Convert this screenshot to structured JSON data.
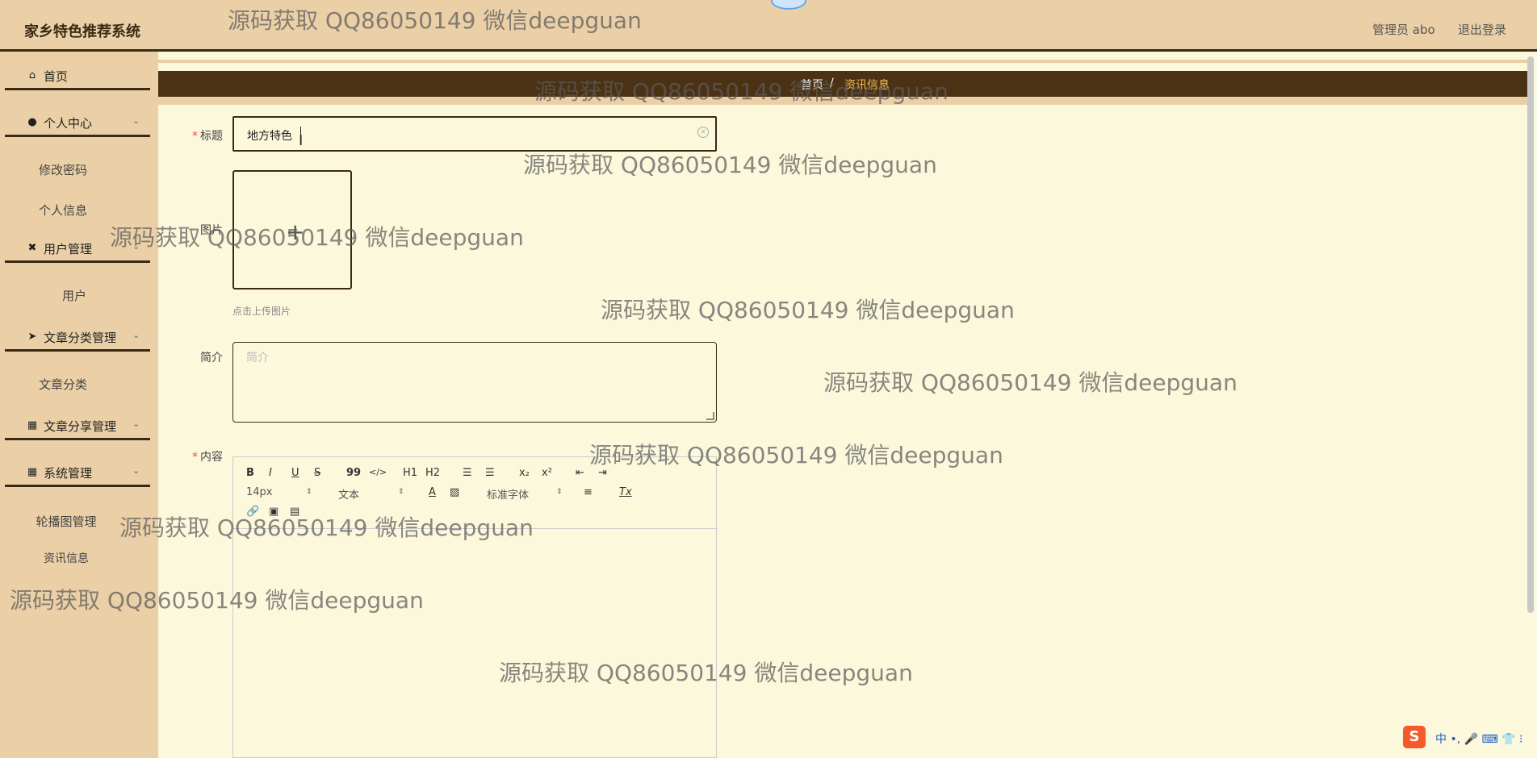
{
  "header": {
    "title": "家乡特色推荐系统",
    "admin": "管理员 abo",
    "logout": "退出登录"
  },
  "sidebar": {
    "home": "首页",
    "personal": "个人中心",
    "change_password": "修改密码",
    "personal_info": "个人信息",
    "user_mgmt": "用户管理",
    "user": "用户",
    "article_cat_mgmt": "文章分类管理",
    "article_cat": "文章分类",
    "article_share_mgmt": "文章分享管理",
    "system_mgmt": "系统管理",
    "carousel_mgmt": "轮播图管理",
    "news_info": "资讯信息"
  },
  "breadcrumb": {
    "home": "首页",
    "sep": "/",
    "current": "资讯信息"
  },
  "form": {
    "title_label": "标题",
    "title_value": "地方特色",
    "image_label": "图片",
    "upload_hint": "点击上传图片",
    "intro_label": "简介",
    "intro_placeholder": "简介",
    "content_label": "内容"
  },
  "editor": {
    "bold": "B",
    "italic": "I",
    "underline": "U",
    "strike": "S",
    "quote": "99",
    "code": "</>",
    "h1": "H1",
    "h2": "H2",
    "sub": "x₂",
    "sup": "x²",
    "size": "14px",
    "format": "文本",
    "font": "标准字体",
    "color": "A",
    "clean": "Tx"
  },
  "watermark": "源码获取 QQ86050149 微信deepguan",
  "ime": {
    "logo": "S",
    "text": "中 •, 🎤 ⌨ 👕 ⁝"
  }
}
